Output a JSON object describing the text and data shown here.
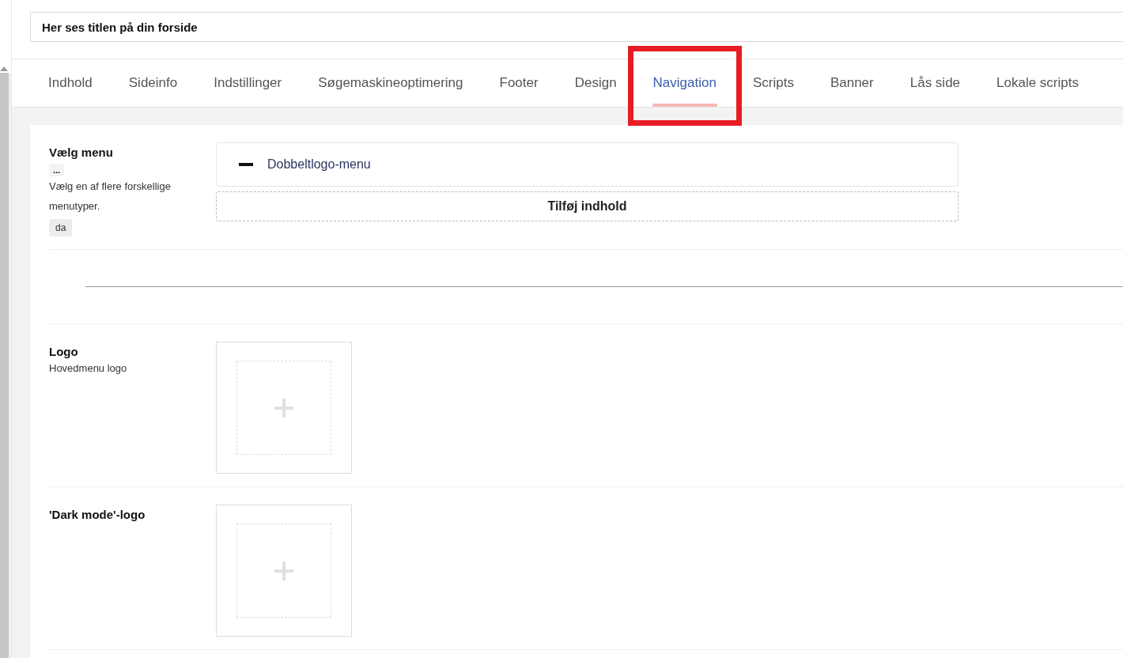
{
  "title_field": {
    "value": "Her ses titlen på din forside"
  },
  "tabs": [
    {
      "label": "Indhold",
      "selected": false,
      "highlighted": false
    },
    {
      "label": "Sideinfo",
      "selected": false,
      "highlighted": false
    },
    {
      "label": "Indstillinger",
      "selected": false,
      "highlighted": false
    },
    {
      "label": "Søgemaskineoptimering",
      "selected": false,
      "highlighted": false
    },
    {
      "label": "Footer",
      "selected": false,
      "highlighted": false
    },
    {
      "label": "Design",
      "selected": false,
      "highlighted": false
    },
    {
      "label": "Navigation",
      "selected": true,
      "highlighted": true
    },
    {
      "label": "Scripts",
      "selected": false,
      "highlighted": false
    },
    {
      "label": "Banner",
      "selected": false,
      "highlighted": false
    },
    {
      "label": "Lås side",
      "selected": false,
      "highlighted": false
    },
    {
      "label": "Lokale scripts",
      "selected": false,
      "highlighted": false
    }
  ],
  "properties": [
    {
      "kind": "blocklist",
      "label": "Vælg menu",
      "actions": "...",
      "description": "Vælg en af flere forskellige menutyper.",
      "culture": "da",
      "items": [
        "Dobbeltlogo-menu"
      ],
      "add_label": "Tilføj indhold"
    },
    {
      "kind": "divider"
    },
    {
      "kind": "image",
      "label": "Logo",
      "description": "Hovedmenu logo"
    },
    {
      "kind": "image",
      "label": "'Dark mode'-logo"
    }
  ]
}
